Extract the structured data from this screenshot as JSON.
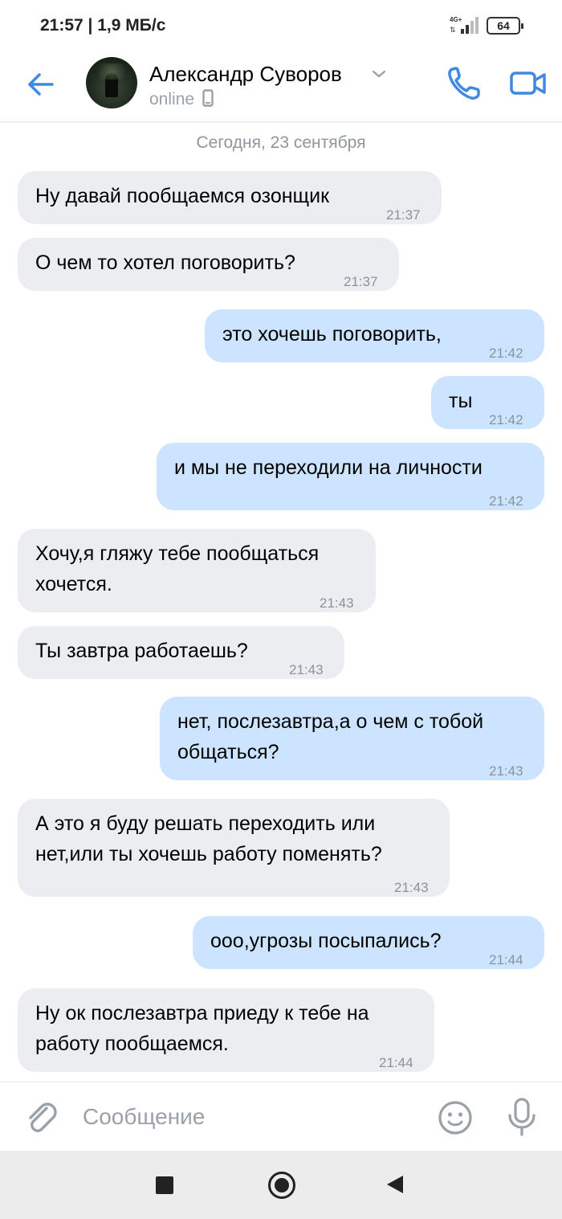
{
  "status_bar": {
    "time": "21:57 | 1,9 МБ/с",
    "network": "4G+",
    "battery": "64"
  },
  "header": {
    "contact_name": "Александр Суворов",
    "contact_status": "online"
  },
  "date_separator": "Сегодня, 23 сентября",
  "messages": [
    {
      "direction": "incoming",
      "lines": [
        "Ну давай пообщаемся озонщик"
      ],
      "time": "21:37"
    },
    {
      "direction": "incoming",
      "lines": [
        "О чем то хотел поговорить?"
      ],
      "time": "21:37"
    },
    {
      "direction": "outgoing",
      "lines": [
        "это хочешь поговорить,"
      ],
      "time": "21:42"
    },
    {
      "direction": "outgoing",
      "lines": [
        "ты"
      ],
      "time": "21:42"
    },
    {
      "direction": "outgoing",
      "lines": [
        "и мы не переходили на личности"
      ],
      "time": "21:42"
    },
    {
      "direction": "incoming",
      "lines": [
        "Хочу,я гляжу тебе пообщаться",
        "хочется."
      ],
      "time": "21:43"
    },
    {
      "direction": "incoming",
      "lines": [
        "Ты завтра работаешь?"
      ],
      "time": "21:43"
    },
    {
      "direction": "outgoing",
      "lines": [
        "нет, послезавтра,а о чем с тобой",
        "общаться?"
      ],
      "time": "21:43"
    },
    {
      "direction": "incoming",
      "lines": [
        "А это я буду решать переходить или",
        "нет,или ты хочешь работу поменять?"
      ],
      "time": "21:43"
    },
    {
      "direction": "outgoing",
      "lines": [
        "ооо,угрозы посыпались?"
      ],
      "time": "21:44"
    },
    {
      "direction": "incoming",
      "lines": [
        "Ну ок послезавтра приеду к тебе на",
        "работу пообщаемся."
      ],
      "time": "21:44"
    }
  ],
  "composer": {
    "placeholder": "Сообщение"
  },
  "colors": {
    "accent": "#3f8ae0",
    "incoming_bubble": "#ebedf0",
    "outgoing_bubble": "#cce4ff"
  },
  "icons": [
    "back-arrow-icon",
    "chevron-down-icon",
    "phone-icon",
    "phone-device-icon",
    "video-camera-icon",
    "paperclip-icon",
    "emoji-icon",
    "microphone-icon",
    "nav-recents-icon",
    "nav-home-icon",
    "nav-back-icon"
  ]
}
